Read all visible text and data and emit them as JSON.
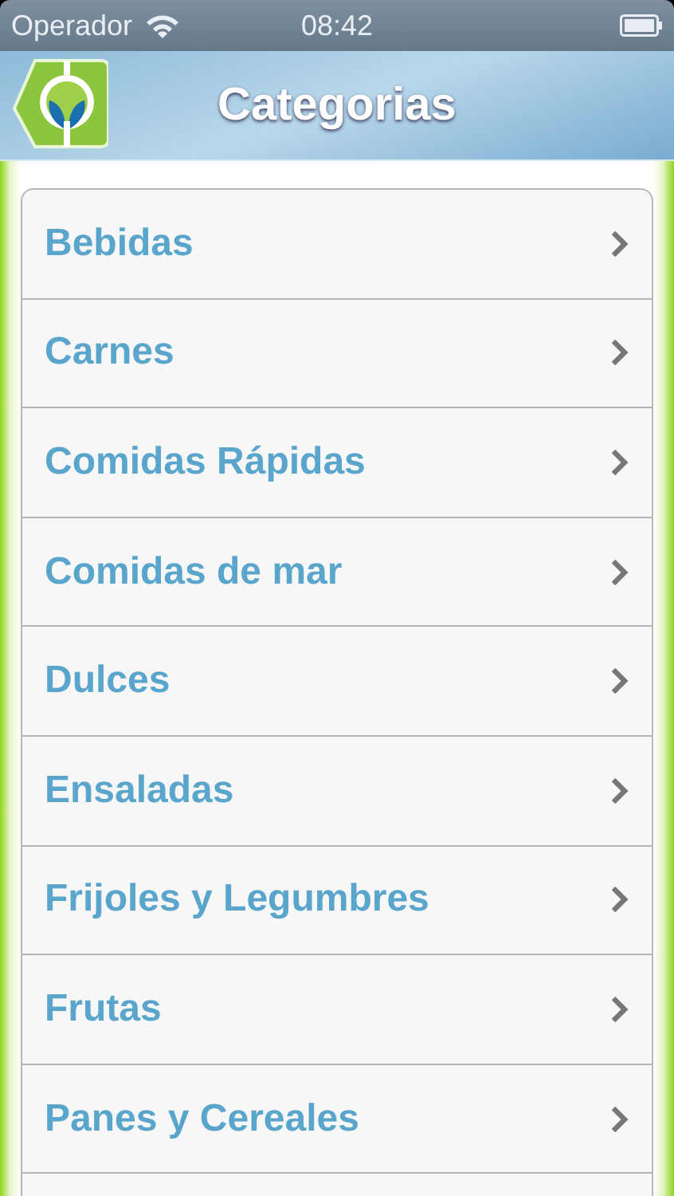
{
  "status_bar": {
    "carrier": "Operador",
    "time": "08:42"
  },
  "nav_bar": {
    "title": "Categorias"
  },
  "categories": [
    {
      "label": "Bebidas"
    },
    {
      "label": "Carnes"
    },
    {
      "label": "Comidas Rápidas"
    },
    {
      "label": "Comidas de mar"
    },
    {
      "label": "Dulces"
    },
    {
      "label": "Ensaladas"
    },
    {
      "label": "Frijoles y Legumbres"
    },
    {
      "label": "Frutas"
    },
    {
      "label": "Panes y Cereales"
    }
  ]
}
